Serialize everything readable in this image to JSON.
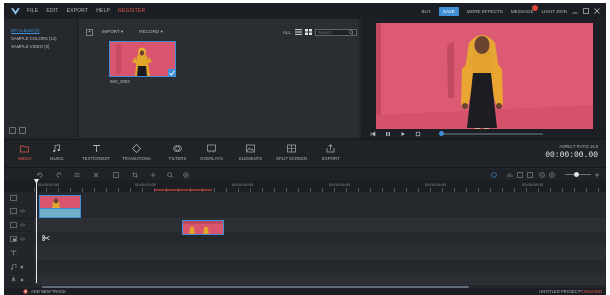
{
  "menu": {
    "items": [
      "FILE",
      "EDIT",
      "EXPORT",
      "HELP"
    ],
    "register": "REGISTER"
  },
  "top_right": {
    "buy": "BUY",
    "save": "SAVE",
    "more_effects": "MORE EFFECTS",
    "messages": "MESSAGE",
    "theme": "LIGHT SKIN"
  },
  "library": {
    "items": [
      "MY ALBUM (0)",
      "SAMPLE COLORS (13)",
      "SAMPLE VIDEO (0)"
    ]
  },
  "media": {
    "import_label": "IMPORT",
    "record_label": "RECORD",
    "all_label": "ALL",
    "search_placeholder": "Search",
    "thumbnail_name": "IMG_9093"
  },
  "toolbar": {
    "tools": [
      "MEDIA",
      "MUSIC",
      "TEXT/CREDIT",
      "TRANSITIONS",
      "FILTERS",
      "OVERLAYS",
      "ELEMENTS",
      "SPLIT SCREEN",
      "EXPORT"
    ],
    "active_tool": "MEDIA",
    "aspect_label": "ASPECT RATIO 16:9",
    "current_time": "00:00:00.00"
  },
  "ruler": {
    "labels": [
      "00:00:00:00",
      "00:00:02:00",
      "00:00:04:00",
      "00:00:06:00",
      "00:00:08:00"
    ]
  },
  "status": {
    "add_track": "ADD NEW TRACK",
    "project": "UNTITLED PROJECT*",
    "unsaved": "UNSAVED"
  },
  "colors": {
    "accent": "#3e8fd6",
    "highlight": "#e55b4c",
    "clip_background": "#d9556d",
    "subject_scarf": "#e1a62a"
  }
}
